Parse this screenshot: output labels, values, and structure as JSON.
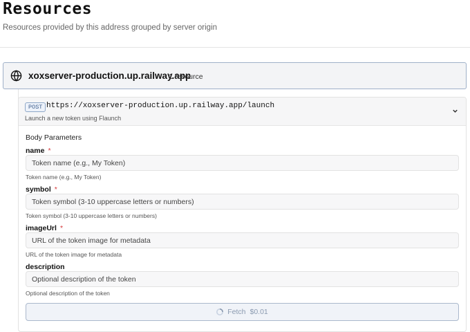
{
  "header": {
    "title": "Resources",
    "subtitle": "Resources provided by this address grouped by server origin"
  },
  "origin": {
    "host": "xoxserver-production.up.railway.app",
    "count_label": "1 resource",
    "icon": "globe-icon"
  },
  "resource": {
    "method": "POST",
    "url": "https://xoxserver-production.up.railway.app/launch",
    "description": "Launch a new token using Flaunch",
    "section_title": "Body Parameters",
    "fields": [
      {
        "name": "name",
        "required_mark": "*",
        "placeholder": "Token name (e.g., My Token)",
        "help": "Token name (e.g., My Token)"
      },
      {
        "name": "symbol",
        "required_mark": "*",
        "placeholder": "Token symbol (3-10 uppercase letters or numbers)",
        "help": "Token symbol (3-10 uppercase letters or numbers)"
      },
      {
        "name": "imageUrl",
        "required_mark": "*",
        "placeholder": "URL of the token image for metadata",
        "help": "URL of the token image for metadata"
      },
      {
        "name": "description",
        "placeholder": "Optional description of the token",
        "help": "Optional description of the token"
      }
    ],
    "fetch_label": "Fetch",
    "fetch_price": "$0.01"
  },
  "colors": {
    "accent_border": "#9fb0c8",
    "required": "#d6393b"
  }
}
